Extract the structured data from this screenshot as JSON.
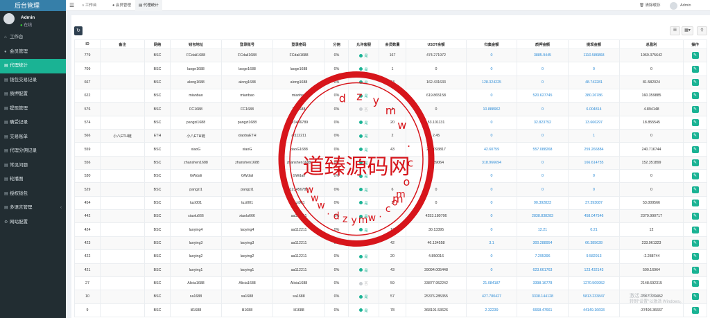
{
  "sidebar": {
    "brand": "后台管理",
    "user": {
      "name": "Admin",
      "status": "在线"
    },
    "items": [
      {
        "label": "工作台",
        "icon": "dashboard-icon"
      },
      {
        "label": "会员管理",
        "icon": "user-icon"
      },
      {
        "label": "代理统计",
        "icon": "list-icon",
        "active": true
      },
      {
        "label": "钱包交易记录",
        "icon": "list-icon"
      },
      {
        "label": "质押配置",
        "icon": "list-icon"
      },
      {
        "label": "提现管理",
        "icon": "list-icon"
      },
      {
        "label": "确受记录",
        "icon": "list-icon"
      },
      {
        "label": "交易账单",
        "icon": "list-icon"
      },
      {
        "label": "代理分佣记录",
        "icon": "list-icon"
      },
      {
        "label": "常见问题",
        "icon": "list-icon"
      },
      {
        "label": "轮播图",
        "icon": "list-icon"
      },
      {
        "label": "授权钱包",
        "icon": "list-icon"
      },
      {
        "label": "多语言管理",
        "icon": "list-icon",
        "arrow": true
      },
      {
        "label": "网站配置",
        "icon": "gear-icon"
      }
    ]
  },
  "topbar": {
    "tabs": [
      {
        "label": "工作台",
        "icon": "dashboard-icon"
      },
      {
        "label": "会员管理",
        "icon": "user-icon"
      },
      {
        "label": "代理统计",
        "icon": "list-icon",
        "active": true
      }
    ],
    "clear_cache": "清除缓存",
    "user_name": "Admin"
  },
  "table": {
    "columns": [
      "ID",
      "备注",
      "网络",
      "钱包地址",
      "登录账号",
      "登录密码",
      "分佣",
      "允许客服",
      "会员数量",
      "USDT余额",
      "归集金额",
      "质押金额",
      "提现金额",
      "总盈利",
      "操作"
    ],
    "rows": [
      [
        "779",
        "",
        "BSC",
        "FCdali1688",
        "FCdali1688",
        "FCdali1688",
        "0%",
        "是",
        "167",
        "474.271972",
        "0",
        "3885.9445",
        "1110.586868",
        "1969.375642"
      ],
      [
        "709",
        "",
        "BSC",
        "laoge1688",
        "laoge1688",
        "laoge1688",
        "0%",
        "是",
        "1",
        "0",
        "0",
        "0",
        "0",
        "0"
      ],
      [
        "667",
        "",
        "BSC",
        "along1688",
        "along1688",
        "along1688",
        "0%",
        "是",
        "13",
        "162.431633",
        "128.324225",
        "0",
        "48.742281",
        "81.582024"
      ],
      [
        "622",
        "",
        "BSC",
        "mianbao",
        "mianbao",
        "mianbao",
        "0%",
        "是",
        "",
        "619.865158",
        "0",
        "520.627745",
        "380.26786",
        "160.359885"
      ],
      [
        "576",
        "",
        "BSC",
        "FC1688",
        "FC1688",
        "FC1688",
        "0%",
        "否",
        "4",
        "0",
        "10.888962",
        "0",
        "6.004814",
        "4.894148"
      ],
      [
        "574",
        "",
        "BSC",
        "pangzi1688",
        "pangzi1688",
        "123456789",
        "0%",
        "是",
        "20",
        "53.101131",
        "0",
        "32.823752",
        "13.666297",
        "18.855545"
      ],
      [
        "566",
        "小八ETH链",
        "ETH",
        "小八ETH链",
        "xiaobaETH",
        "at112211",
        "0%",
        "是",
        "2",
        "2.45",
        "0",
        "0",
        "1",
        "0"
      ],
      [
        "559",
        "",
        "BSC",
        "xiaoG",
        "xiaoG",
        "xiaoG1688",
        "0%",
        "是",
        "43",
        "258.093817",
        "42.60759",
        "557.088268",
        "259.266884",
        "240.716744"
      ],
      [
        "556",
        "",
        "BSC",
        "zhanshen1688",
        "zhanshen1688",
        "zhanshen1688",
        "0%",
        "是",
        "",
        "4.989064",
        "318.966694",
        "0",
        "166.614755",
        "152.351899"
      ],
      [
        "530",
        "",
        "BSC",
        "GWdali",
        "GWdali",
        "GWdali",
        "0%",
        "是",
        "",
        "",
        "0",
        "0",
        "0",
        "0"
      ],
      [
        "529",
        "",
        "BSC",
        "pangzi1",
        "pangzi1",
        "123456789",
        "0%",
        "是",
        "6",
        "0",
        "0",
        "0",
        "0",
        "0"
      ],
      [
        "454",
        "",
        "BSC",
        "tuzi001",
        "tuzi001",
        "tuzi001",
        "0%",
        "是",
        "3",
        "0",
        "0",
        "90.392823",
        "37.393087",
        "53.009566"
      ],
      [
        "442",
        "",
        "BSC",
        "xiaolu666",
        "xiaolu666",
        "aa112211",
        "0%",
        "是",
        "",
        "4253.180706",
        "0",
        "2838.838283",
        "458.047546",
        "2379.990717"
      ],
      [
        "424",
        "",
        "BSC",
        "laoying4",
        "laoying4",
        "aa112211",
        "0%",
        "是",
        "13",
        "30.13395",
        "0",
        "12.21",
        "0.21",
        "12"
      ],
      [
        "423",
        "",
        "BSC",
        "laoying3",
        "laoying3",
        "aa112211",
        "0%",
        "是",
        "42",
        "46.134558",
        "3.1",
        "300.288954",
        "66.385628",
        "233.961323"
      ],
      [
        "422",
        "",
        "BSC",
        "laoying2",
        "laoying2",
        "aa112211",
        "0%",
        "是",
        "20",
        "4.850016",
        "0",
        "7.295396",
        "9.582913",
        "-2.288744"
      ],
      [
        "421",
        "",
        "BSC",
        "laoying1",
        "laoying1",
        "aa112211",
        "0%",
        "是",
        "43",
        "39094.005448",
        "0",
        "623.661763",
        "123.432143",
        "500.16964"
      ],
      [
        "27",
        "",
        "BSC",
        "Alicia1688",
        "Alicia1688",
        "Alicia1688",
        "0%",
        "否",
        "59",
        "33877.952242",
        "21.084187",
        "3398.16778",
        "1270.509952",
        "2148.692315"
      ],
      [
        "10",
        "",
        "BSC",
        "sa1688",
        "sa1688",
        "sa1688",
        "0%",
        "是",
        "57",
        "25376.285355",
        "427.780427",
        "3338.144128",
        "5813.233847",
        "-2047.339452"
      ],
      [
        "9",
        "",
        "BSC",
        "lil1688",
        "lil1688",
        "lil1688",
        "0%",
        "是",
        "78",
        "368191.53626",
        "2.32239",
        "6668.47661",
        "44149.16693",
        "-37496.36667"
      ]
    ]
  },
  "watermark": {
    "center": "道臻源码网",
    "top_letters": [
      "d",
      "z",
      "y",
      "m",
      "w",
      ".",
      "c",
      "o",
      "m"
    ],
    "bottom_letters": [
      "w",
      "w",
      "w",
      ".",
      "d",
      "z",
      "y",
      "m",
      "w",
      ".",
      "c",
      "o",
      "m"
    ]
  },
  "windows_notice": {
    "title": "激活 Windows",
    "text": "转到\"设置\"以激活 Windows。"
  }
}
